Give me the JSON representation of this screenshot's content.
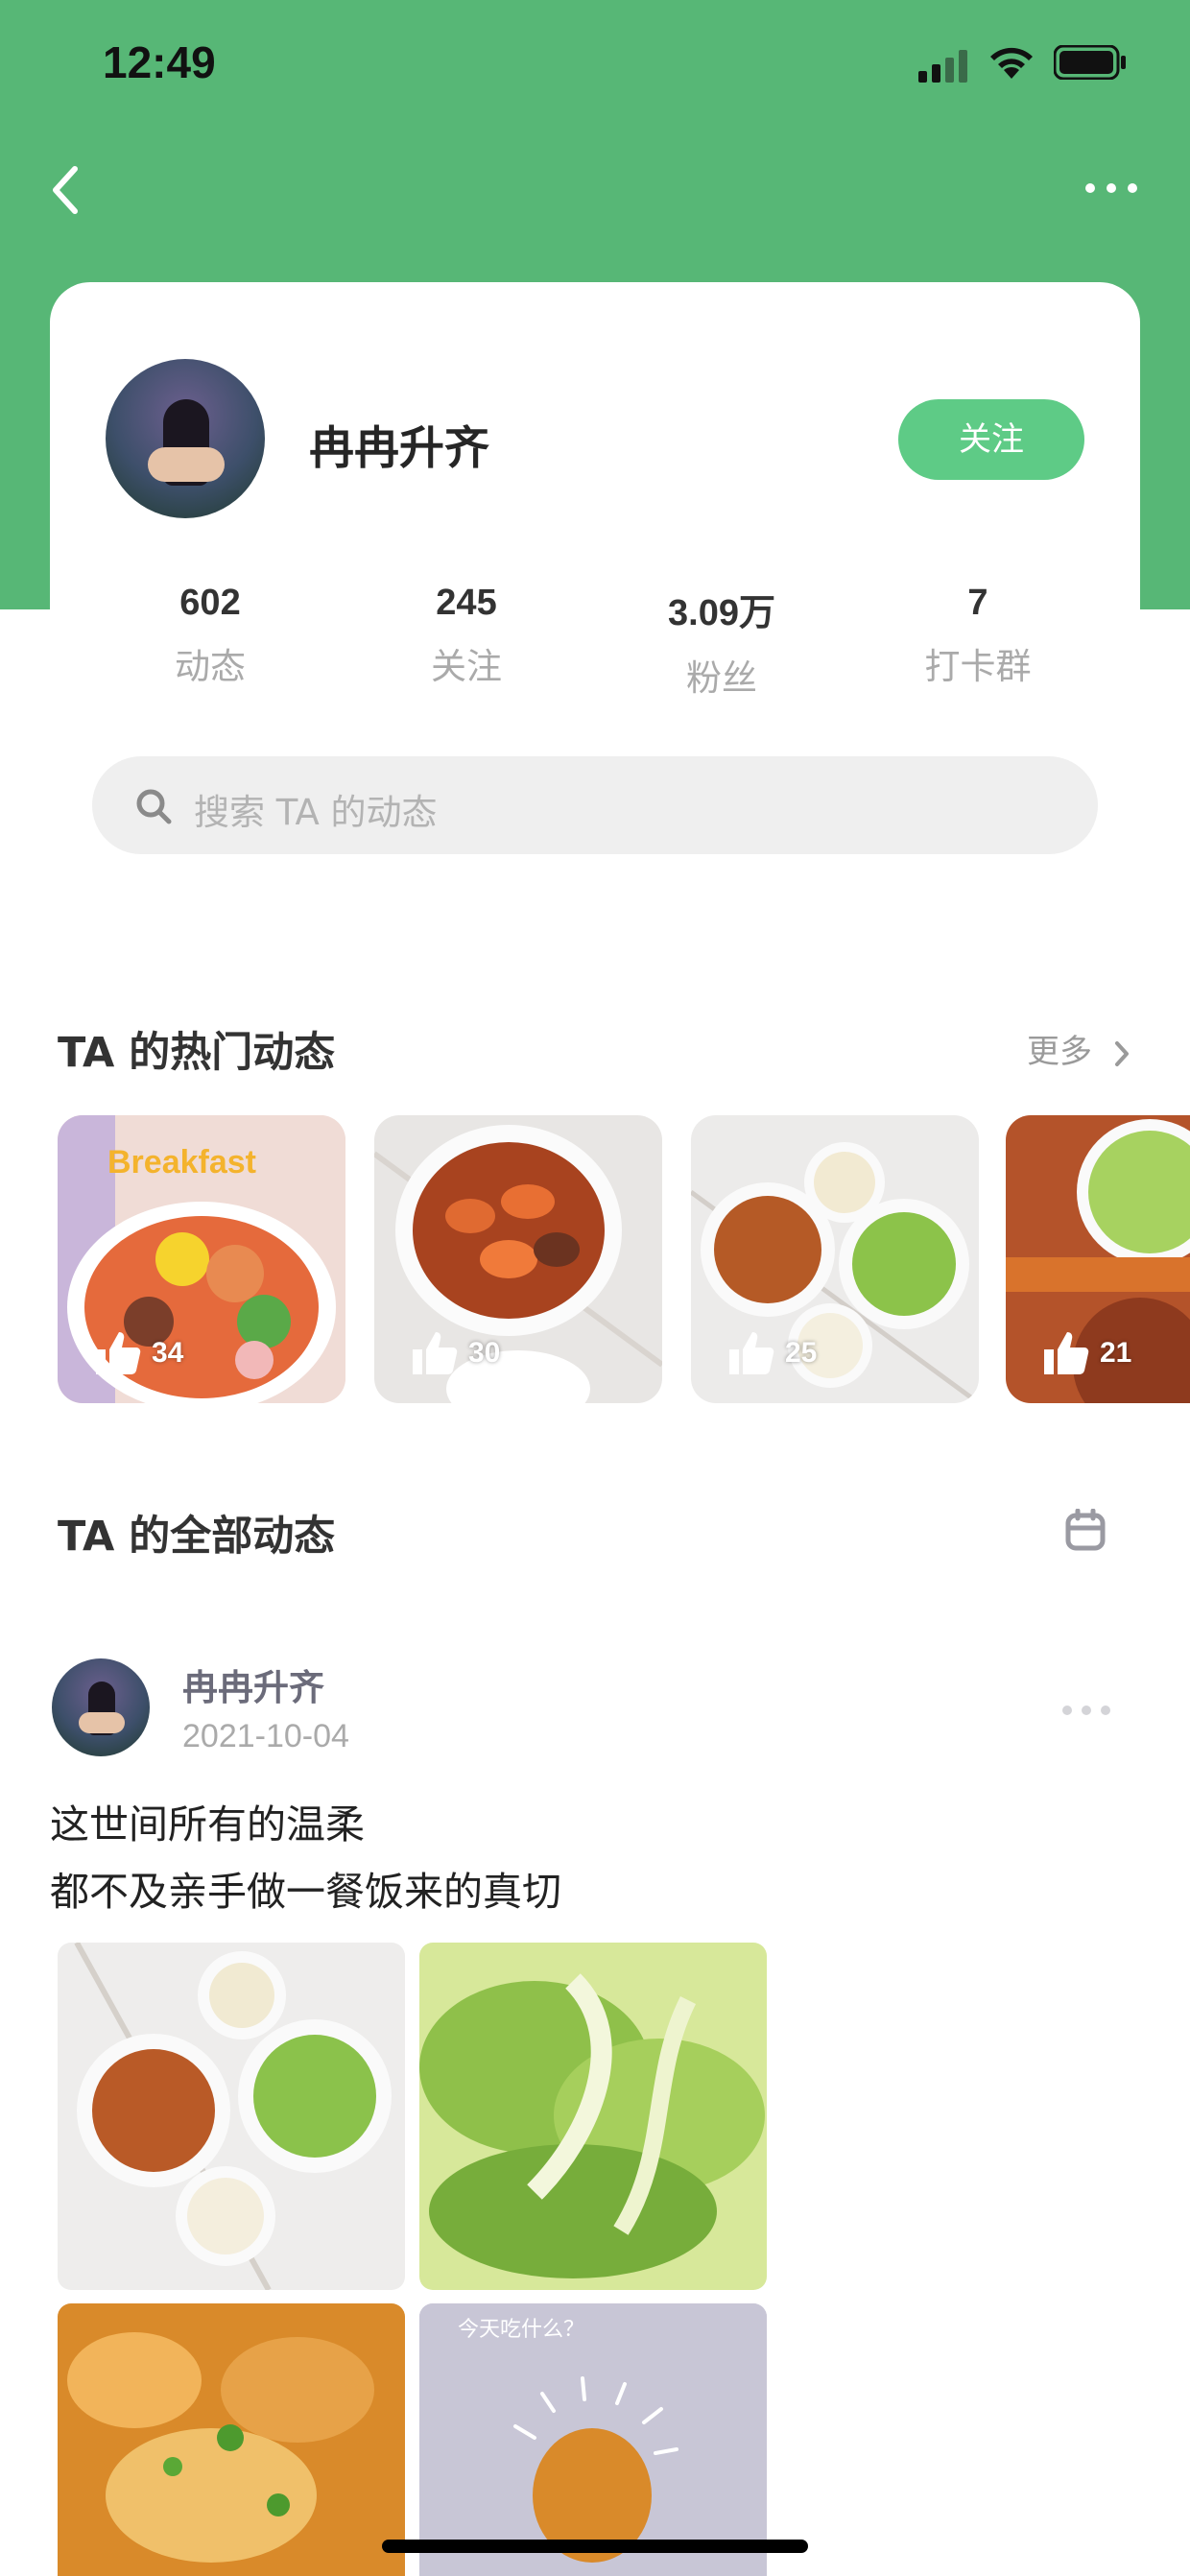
{
  "status_bar": {
    "time": "12:49"
  },
  "profile": {
    "name": "冉冉升齐",
    "follow_label": "关注",
    "stats": [
      {
        "value": "602",
        "label": "动态"
      },
      {
        "value": "245",
        "label": "关注"
      },
      {
        "value": "3.09万",
        "label": "粉丝"
      },
      {
        "value": "7",
        "label": "打卡群"
      }
    ]
  },
  "search": {
    "placeholder": "搜索 TA 的动态"
  },
  "hot": {
    "title": "TA 的热门动态",
    "more_label": "更多",
    "items": [
      {
        "likes": "34",
        "caption": "Breakfast"
      },
      {
        "likes": "30"
      },
      {
        "likes": "25"
      },
      {
        "likes": "21"
      }
    ]
  },
  "all": {
    "title": "TA 的全部动态"
  },
  "post": {
    "author": "冉冉升齐",
    "date": "2021-10-04",
    "lines": [
      "这世间所有的温柔",
      "都不及亲手做一餐饭来的真切"
    ],
    "image_caption": "今天吃什么？"
  },
  "colors": {
    "header": "#57b776",
    "follow": "#5ecb86"
  },
  "icons": [
    "back-icon",
    "more-icon",
    "search-icon",
    "chevron-right-icon",
    "thumbs-up-icon",
    "calendar-icon"
  ]
}
